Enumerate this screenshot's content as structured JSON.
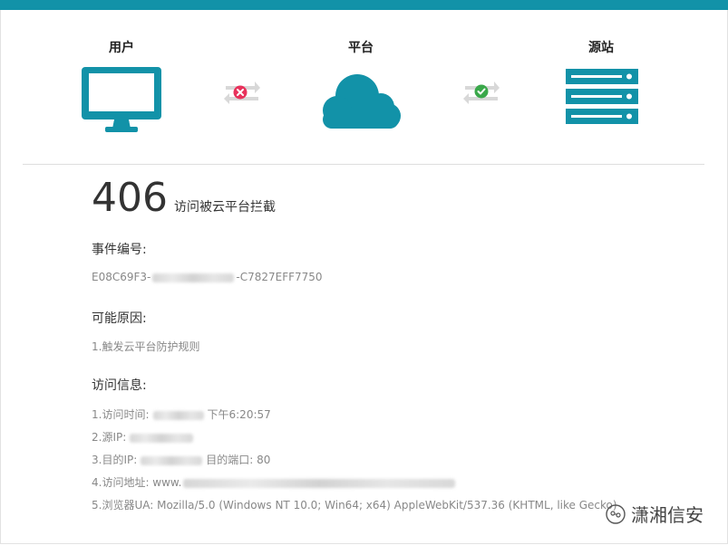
{
  "diagram": {
    "user_label": "用户",
    "platform_label": "平台",
    "origin_label": "源站",
    "user_link_status": "blocked",
    "origin_link_status": "ok"
  },
  "error": {
    "code": "406",
    "message": "访问被云平台拦截"
  },
  "event": {
    "heading": "事件编号:",
    "id_prefix": "E08C69F3-",
    "id_suffix": "-C7827EFF7750"
  },
  "reason": {
    "heading": "可能原因:",
    "item1": "1.触发云平台防护规则"
  },
  "access": {
    "heading": "访问信息:",
    "time_label": "1.访问时间:",
    "time_value": "下午6:20:57",
    "source_ip_label": "2.源IP:",
    "dest_ip_label": "3.目的IP:",
    "dest_port_text": "目的端口: 80",
    "url_label": "4.访问地址: www.",
    "ua_text": "5.浏览器UA: Mozilla/5.0 (Windows NT 10.0; Win64; x64) AppleWebKit/537.36 (KHTML, like Gecko)"
  },
  "watermark": {
    "text": "潇湘信安"
  },
  "colors": {
    "brand": "#1292a8",
    "blocked": "#e8325c",
    "ok": "#3aa84a"
  }
}
